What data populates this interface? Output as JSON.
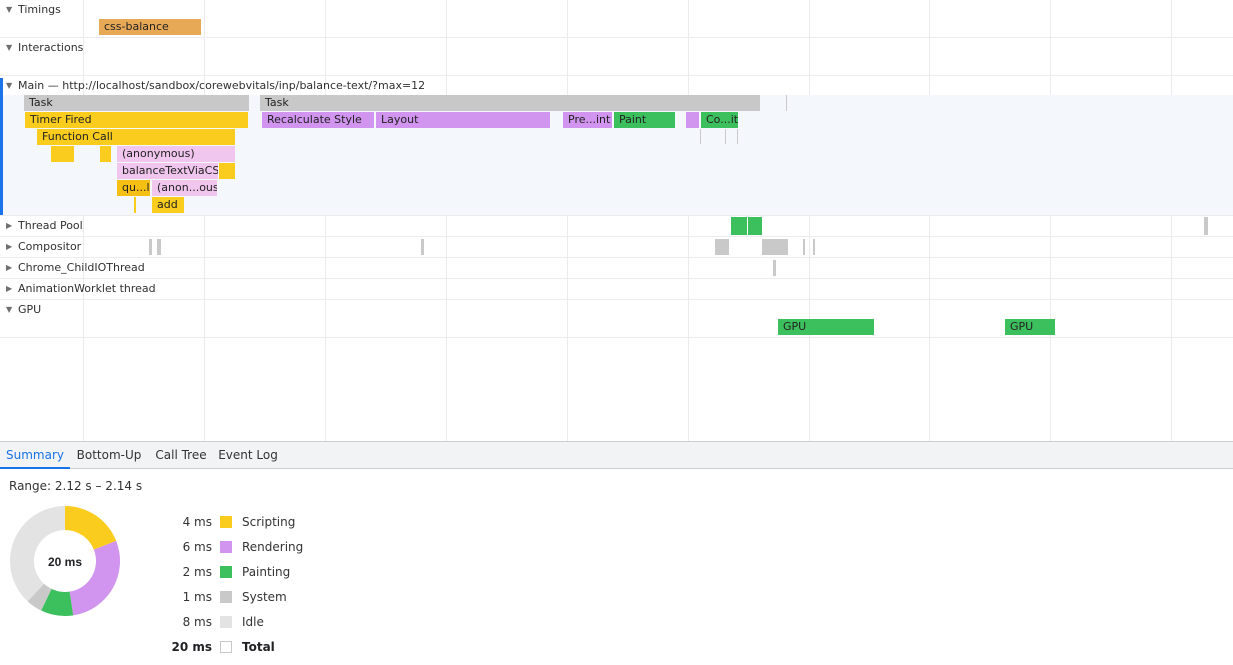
{
  "tracks": {
    "timings": "Timings",
    "interactions": "Interactions",
    "main": "Main — http://localhost/sandbox/corewebvitals/inp/balance-text/?max=12",
    "thread_pool": "Thread Pool",
    "compositor": "Compositor",
    "child_io": "Chrome_ChildIOThread",
    "animation_worklet": "AnimationWorklet thread",
    "gpu": "GPU"
  },
  "events": {
    "css_balance": "css-balance",
    "task_1": "Task",
    "task_2": "Task",
    "timer_fired": "Timer Fired",
    "function_call": "Function Call",
    "anonymous": "(anonymous)",
    "balance_text": "balanceTextViaCSS",
    "qu": "qu...l",
    "anon_ous": "(anon...ous)",
    "add": "add",
    "recalculate_style": "Recalculate Style",
    "layout": "Layout",
    "pre_int": "Pre...int",
    "paint": "Paint",
    "co_it": "Co...it",
    "gpu_1": "GPU",
    "gpu_2": "GPU"
  },
  "tabs": {
    "summary": "Summary",
    "bottom_up": "Bottom-Up",
    "call_tree": "Call Tree",
    "event_log": "Event Log"
  },
  "summary": {
    "range": "Range: 2.12 s – 2.14 s",
    "total_center": "20 ms",
    "scripting_value": "4 ms",
    "scripting_label": "Scripting",
    "rendering_value": "6 ms",
    "rendering_label": "Rendering",
    "painting_value": "2 ms",
    "painting_label": "Painting",
    "system_value": "1 ms",
    "system_label": "System",
    "idle_value": "8 ms",
    "idle_label": "Idle",
    "total_value": "20 ms",
    "total_label": "Total"
  },
  "breakdown_ms": {
    "scripting": 4,
    "rendering": 6,
    "painting": 2,
    "system": 1,
    "idle": 8
  },
  "colors": {
    "scripting": "#f9cc1d",
    "rendering": "#d194ef",
    "painting": "#3cbf5d",
    "system": "#c9c9c9",
    "idle": "#e3e3e3",
    "active_tab": "#1a73e8"
  }
}
